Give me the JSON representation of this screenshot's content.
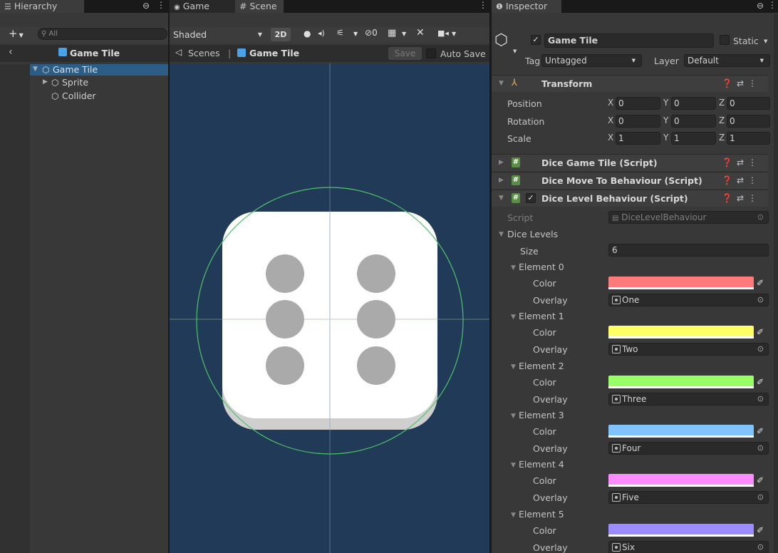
{
  "hierarchy": {
    "tab_label": "Hierarchy",
    "search_placeholder": "All",
    "scene_title": "Game Tile",
    "items": [
      {
        "label": "Game Tile"
      },
      {
        "label": "Sprite"
      },
      {
        "label": "Collider"
      }
    ]
  },
  "scene_view": {
    "tabs": [
      {
        "label": "Game"
      },
      {
        "label": "Scene"
      }
    ],
    "draw_mode": "Shaded",
    "mode_2d": "2D",
    "hidden_count": "0",
    "breadcrumb_root": "Scenes",
    "breadcrumb_current": "Game Tile",
    "save_label": "Save",
    "autosave_label": "Auto Save",
    "dice_pips": 6
  },
  "inspector": {
    "tab_label": "Inspector",
    "object_name": "Game Tile",
    "static_label": "Static",
    "tag_label": "Tag",
    "tag_value": "Untagged",
    "layer_label": "Layer",
    "layer_value": "Default",
    "transform": {
      "title": "Transform",
      "position_label": "Position",
      "rotation_label": "Rotation",
      "scale_label": "Scale",
      "position": {
        "x": "0",
        "y": "0",
        "z": "0"
      },
      "rotation": {
        "x": "0",
        "y": "0",
        "z": "0"
      },
      "scale": {
        "x": "1",
        "y": "1",
        "z": "1"
      }
    },
    "components": [
      {
        "title": "Dice Game Tile (Script)"
      },
      {
        "title": "Dice Move To Behaviour (Script)"
      },
      {
        "title": "Dice Level Behaviour (Script)"
      }
    ],
    "dice_level": {
      "script_label": "Script",
      "script_value": "DiceLevelBehaviour",
      "list_label": "Dice Levels",
      "size_label": "Size",
      "size_value": "6",
      "color_label": "Color",
      "overlay_label": "Overlay",
      "elements": [
        {
          "label": "Element 0",
          "color": "#ff7a7a",
          "overlay": "One"
        },
        {
          "label": "Element 1",
          "color": "#ffff66",
          "overlay": "Two"
        },
        {
          "label": "Element 2",
          "color": "#99ff66",
          "overlay": "Three"
        },
        {
          "label": "Element 3",
          "color": "#7fc4ff",
          "overlay": "Four"
        },
        {
          "label": "Element 4",
          "color": "#ff8cff",
          "overlay": "Five"
        },
        {
          "label": "Element 5",
          "color": "#9c8cff",
          "overlay": "Six"
        }
      ]
    }
  },
  "colors": {
    "scene_background": "#213a58",
    "gizmo_green": "#4fc36b",
    "dice_face": "#ffffff",
    "dice_pip": "#aaaaaa",
    "prefab_blue": "#4aa3e8"
  }
}
